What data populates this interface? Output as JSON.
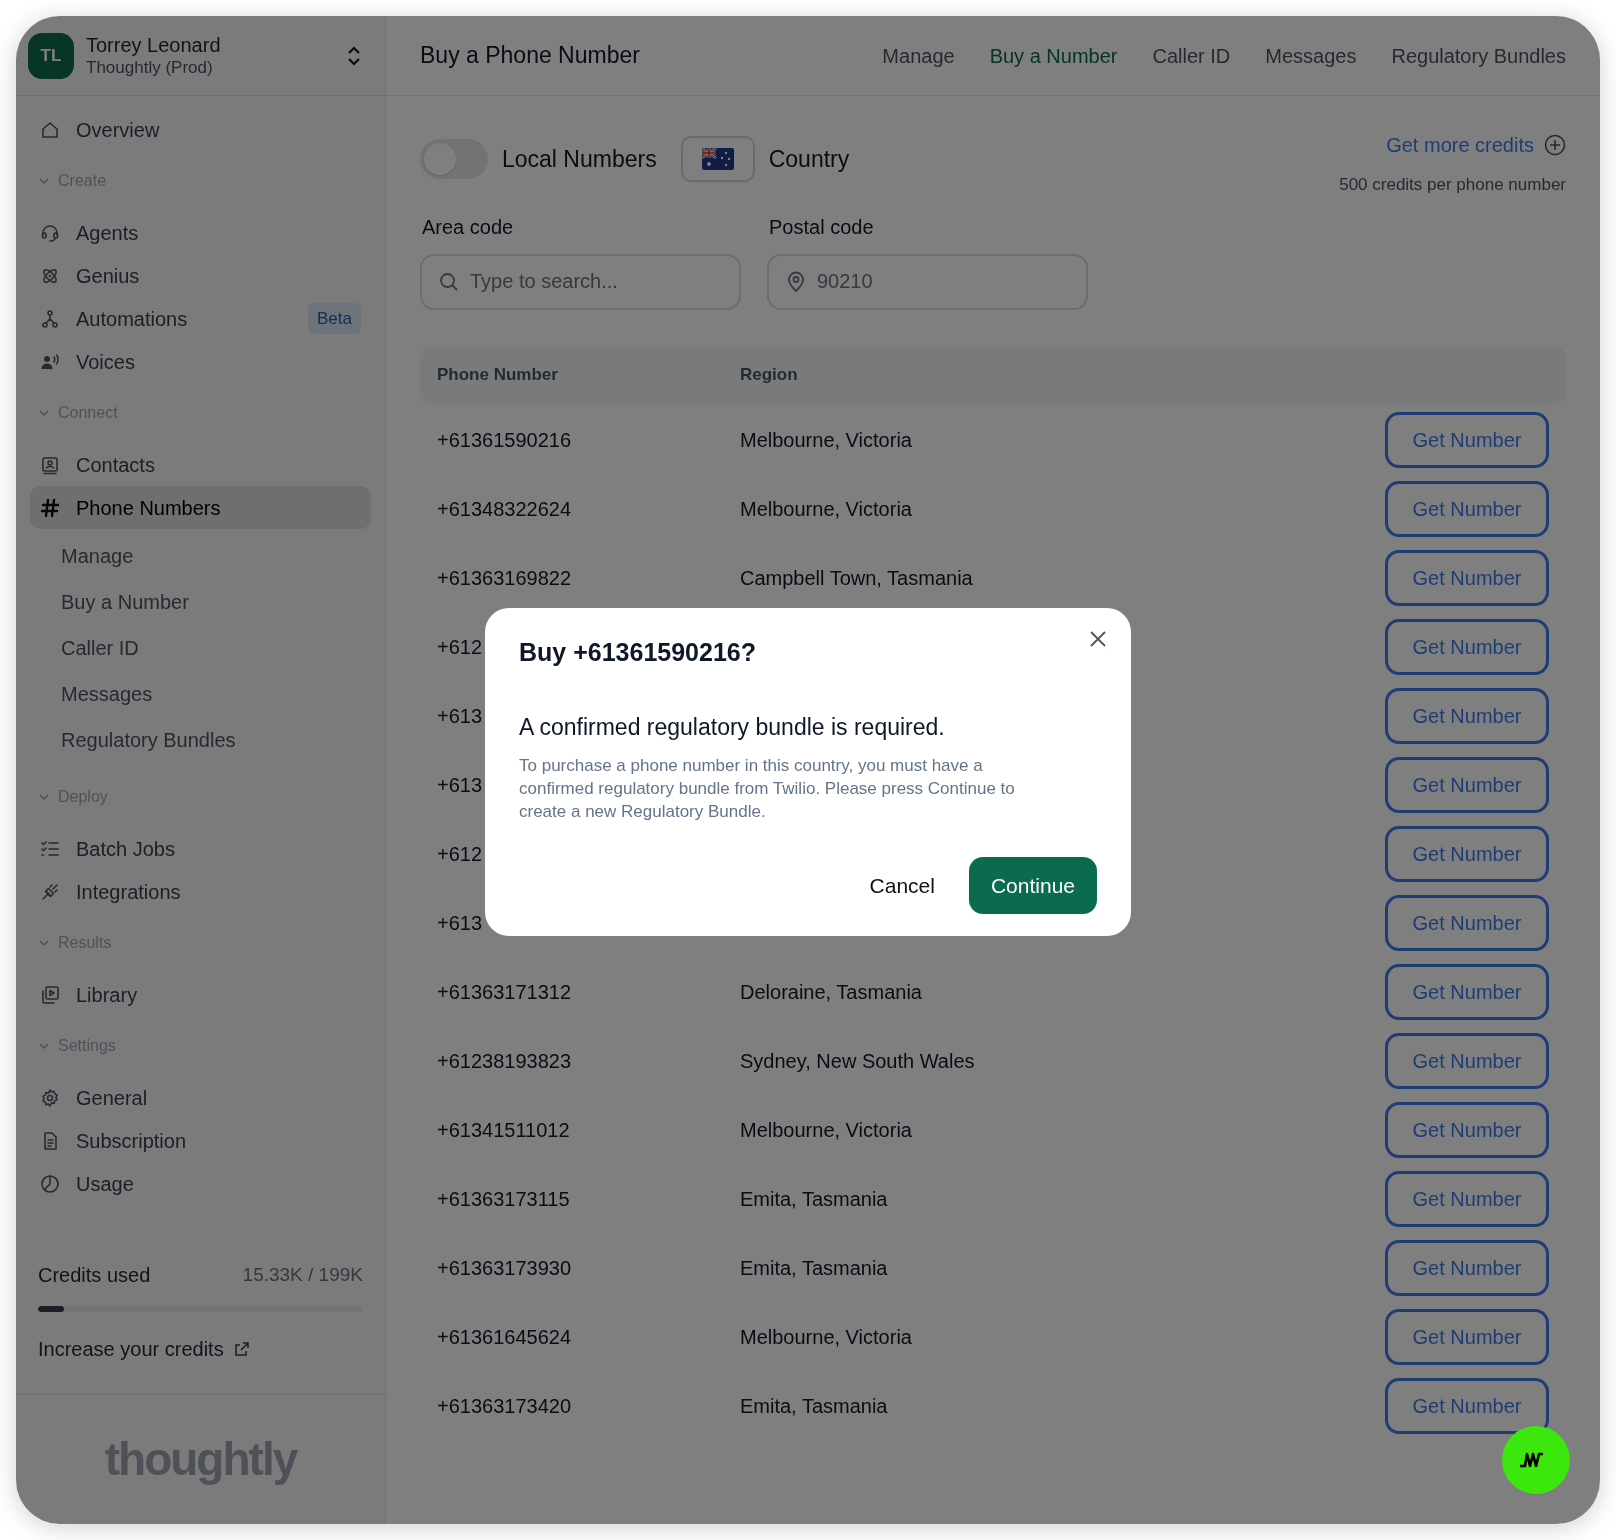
{
  "sidebar": {
    "account": {
      "initials": "TL",
      "name": "Torrey Leonard",
      "workspace": "Thoughtly (Prod)"
    },
    "nav": [
      {
        "kind": "item",
        "label": "Overview",
        "selected": false
      },
      {
        "kind": "section",
        "label": "Create",
        "expanded": true,
        "children": [
          {
            "kind": "item",
            "label": "Agents",
            "selected": false
          },
          {
            "kind": "item",
            "label": "Genius",
            "selected": false
          },
          {
            "kind": "item",
            "label": "Automations",
            "selected": false,
            "badge": "Beta"
          },
          {
            "kind": "item",
            "label": "Voices",
            "selected": false
          }
        ]
      },
      {
        "kind": "section",
        "label": "Connect",
        "expanded": true,
        "children": [
          {
            "kind": "item",
            "label": "Contacts",
            "selected": false
          },
          {
            "kind": "item",
            "label": "Phone Numbers",
            "selected": true,
            "children": [
              {
                "label": "Manage",
                "selected": false
              },
              {
                "label": "Buy a Number",
                "selected": false
              },
              {
                "label": "Caller ID",
                "selected": false
              },
              {
                "label": "Messages",
                "selected": false
              },
              {
                "label": "Regulatory Bundles",
                "selected": false
              }
            ]
          }
        ]
      },
      {
        "kind": "section",
        "label": "Deploy",
        "expanded": true,
        "children": [
          {
            "kind": "item",
            "label": "Batch Jobs",
            "selected": false
          },
          {
            "kind": "item",
            "label": "Integrations",
            "selected": false
          }
        ]
      },
      {
        "kind": "section",
        "label": "Results",
        "expanded": true,
        "children": [
          {
            "kind": "item",
            "label": "Library",
            "selected": false
          }
        ]
      },
      {
        "kind": "section",
        "label": "Settings",
        "expanded": true,
        "children": [
          {
            "kind": "item",
            "label": "General",
            "selected": false
          },
          {
            "kind": "item",
            "label": "Subscription",
            "selected": false
          },
          {
            "kind": "item",
            "label": "Usage",
            "selected": false
          }
        ]
      }
    ],
    "credits": {
      "label": "Credits used",
      "reading": "15.33K / 199K",
      "level": 0.08
    },
    "increase_link": "Increase your credits",
    "logo": "thoughtly"
  },
  "header": {
    "title": "Buy a Phone Number",
    "tabs": [
      {
        "label": "Manage",
        "selected": false
      },
      {
        "label": "Buy a Number",
        "selected": true
      },
      {
        "label": "Caller ID",
        "selected": false
      },
      {
        "label": "Messages",
        "selected": false
      },
      {
        "label": "Regulatory Bundles",
        "selected": false
      }
    ]
  },
  "filters": {
    "local_numbers": {
      "label": "Local Numbers",
      "on": false
    },
    "country": {
      "label": "Country"
    },
    "credits_link": "Get more credits",
    "credits_note": "500 credits per phone number",
    "area_code": {
      "label": "Area code",
      "placeholder": "Type to search..."
    },
    "postal_code": {
      "label": "Postal code",
      "placeholder": "90210"
    }
  },
  "table": {
    "columns": [
      "Phone Number",
      "Region"
    ],
    "rows": [
      {
        "phone_number": "+61361590216",
        "region": "Melbourne, Victoria",
        "action": "Get Number"
      },
      {
        "phone_number": "+61348322624",
        "region": "Melbourne, Victoria",
        "action": "Get Number"
      },
      {
        "phone_number": "+61363169822",
        "region": "Campbell Town, Tasmania",
        "action": "Get Number"
      },
      {
        "phone_number": "+612",
        "action": "Get Number"
      },
      {
        "phone_number": "+613",
        "action": "Get Number"
      },
      {
        "phone_number": "+613",
        "action": "Get Number"
      },
      {
        "phone_number": "+612",
        "action": "Get Number"
      },
      {
        "phone_number": "+613",
        "action": "Get Number"
      },
      {
        "phone_number": "+61363171312",
        "region": "Deloraine, Tasmania",
        "action": "Get Number"
      },
      {
        "phone_number": "+61238193823",
        "region": "Sydney, New South Wales",
        "action": "Get Number"
      },
      {
        "phone_number": "+61341511012",
        "region": "Melbourne, Victoria",
        "action": "Get Number"
      },
      {
        "phone_number": "+61363173115",
        "region": "Emita, Tasmania",
        "action": "Get Number"
      },
      {
        "phone_number": "+61363173930",
        "region": "Emita, Tasmania",
        "action": "Get Number"
      },
      {
        "phone_number": "+61361645624",
        "region": "Melbourne, Victoria",
        "action": "Get Number"
      },
      {
        "phone_number": "+61363173420",
        "region": "Emita, Tasmania",
        "action": "Get Number"
      }
    ]
  },
  "dialog": {
    "title": "Buy +61361590216?",
    "heading": "A confirmed regulatory bundle is required.",
    "message": "To purchase a phone number in this country, you must have a confirmed regulatory bundle from Twilio. Please press Continue to create a new Regulatory Bundle.",
    "buttons": [
      {
        "label": "Cancel",
        "kind": "secondary"
      },
      {
        "label": "Continue",
        "kind": "primary"
      }
    ]
  }
}
